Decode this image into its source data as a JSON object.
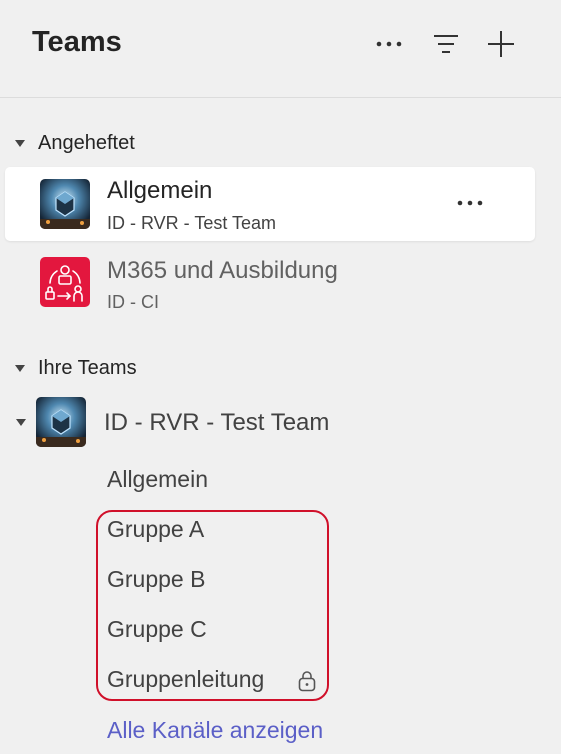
{
  "header": {
    "title": "Teams",
    "icons": [
      "more-icon",
      "filter-icon",
      "add-icon"
    ]
  },
  "pinned": {
    "label": "Angeheftet",
    "items": [
      {
        "title": "Allgemein",
        "subtitle": "ID - RVR - Test Team",
        "selected": true,
        "avatar": "team-avatar-rvr"
      },
      {
        "title": "M365 und Ausbildung",
        "subtitle": "ID - CI",
        "selected": false,
        "avatar": "team-avatar-ci",
        "avatar_color": "#e3173e"
      }
    ]
  },
  "your_teams": {
    "label": "Ihre Teams",
    "team": {
      "name": "ID - RVR - Test Team",
      "channels": [
        {
          "name": "Allgemein",
          "locked": false
        },
        {
          "name": "Gruppe A",
          "locked": false
        },
        {
          "name": "Gruppe B",
          "locked": false
        },
        {
          "name": "Gruppe C",
          "locked": false
        },
        {
          "name": "Gruppenleitung",
          "locked": true
        }
      ],
      "show_all": "Alle Kanäle anzeigen"
    }
  },
  "colors": {
    "accent": "#5b5fc7",
    "highlight": "#d0102a",
    "ci_red": "#e3173e",
    "background": "#f0f0f0"
  }
}
